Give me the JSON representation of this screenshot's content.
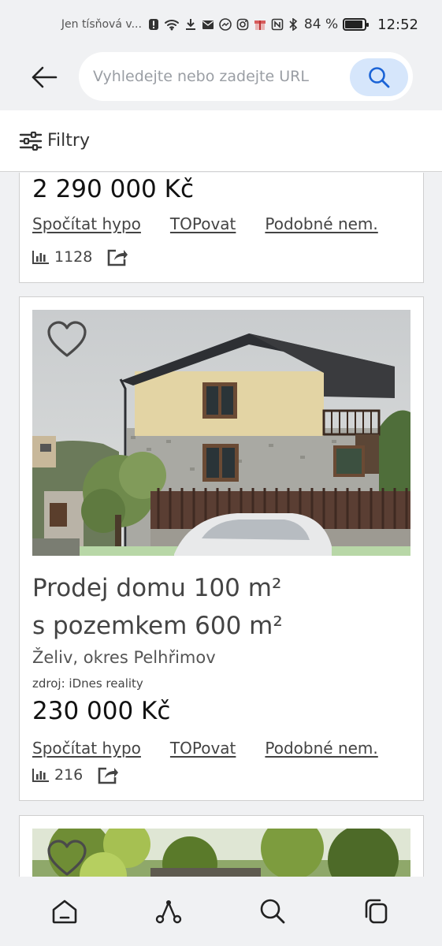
{
  "status_bar": {
    "carrier": "Jen tísňová v...",
    "battery_percent": "84 %",
    "battery_level": 0.84,
    "time": "12:52",
    "icons": [
      "alert-icon",
      "wifi-icon",
      "download-icon",
      "mail-icon",
      "messenger-icon",
      "instagram-icon",
      "gift-icon",
      "nfc-icon",
      "bluetooth-icon"
    ]
  },
  "url_bar": {
    "placeholder": "Vyhledejte nebo zadejte URL"
  },
  "filters": {
    "label": "Filtry"
  },
  "listings": [
    {
      "price": "2 290 000 Kč",
      "links": {
        "hypo": "Spočítat hypo",
        "top": "TOPovat",
        "similar": "Podobné nem."
      },
      "views": "1128"
    },
    {
      "title_line1": "Prodej domu 100 m²",
      "title_line2": "s pozemkem 600 m²",
      "location": "Želiv, okres Pelhřimov",
      "source": "zdroj: iDnes reality",
      "price": "230 000 Kč",
      "links": {
        "hypo": "Spočítat hypo",
        "top": "TOPovat",
        "similar": "Podobné nem."
      },
      "views": "216",
      "favorited": false
    },
    {
      "favorited": false
    }
  ],
  "bottom_nav": [
    "home-icon",
    "route-icon",
    "search-icon",
    "tabs-icon"
  ]
}
